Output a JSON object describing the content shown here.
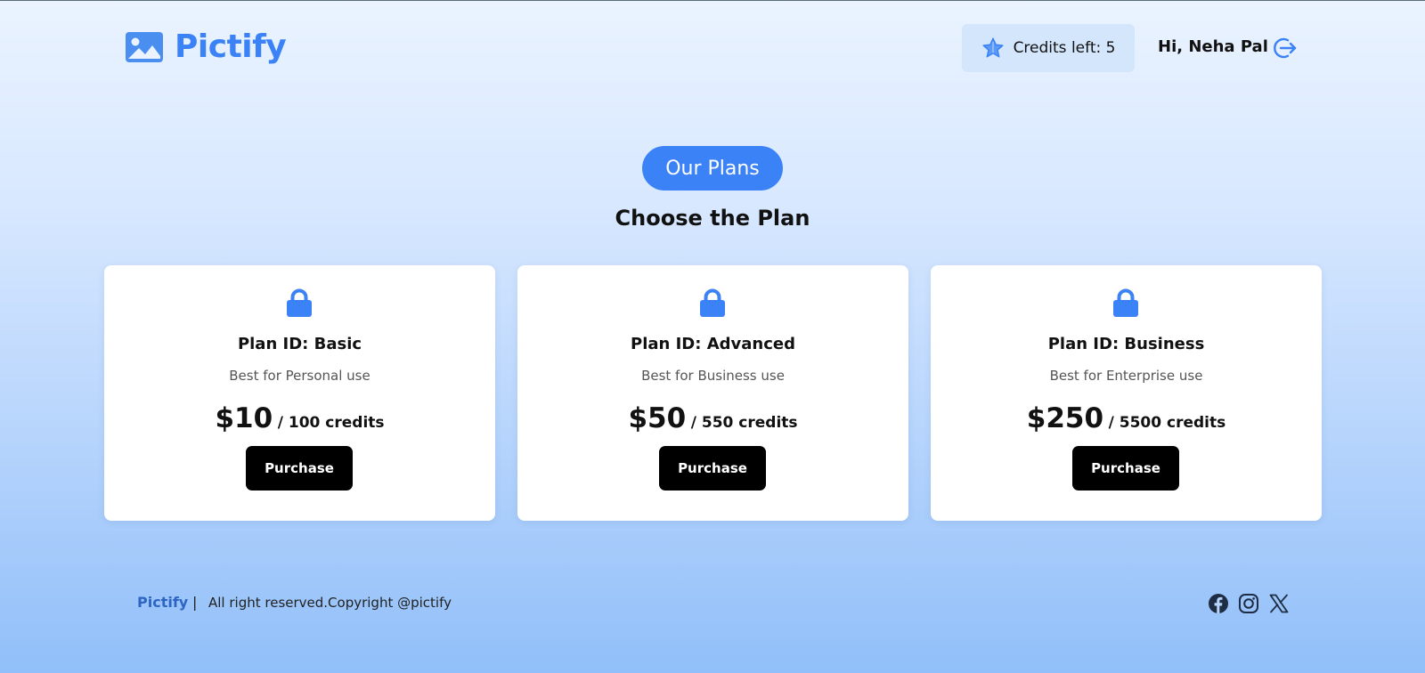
{
  "header": {
    "brand": "Pictify",
    "credits_label": "Credits left: 5",
    "greeting": "Hi, Neha Pal"
  },
  "section": {
    "pill": "Our Plans",
    "title": "Choose the Plan"
  },
  "plans": [
    {
      "id": "Plan ID: Basic",
      "desc": "Best for Personal use",
      "price": "$10",
      "credits": "/ 100 credits",
      "button": "Purchase"
    },
    {
      "id": "Plan ID: Advanced",
      "desc": "Best for Business use",
      "price": "$50",
      "credits": "/ 550 credits",
      "button": "Purchase"
    },
    {
      "id": "Plan ID: Business",
      "desc": "Best for Enterprise use",
      "price": "$250",
      "credits": "/ 5500 credits",
      "button": "Purchase"
    }
  ],
  "footer": {
    "brand": "Pictify",
    "separator": "|",
    "copyright": "All right reserved.Copyright @pictify"
  },
  "icons": {
    "logo": "image-icon",
    "credits": "star-icon",
    "logout": "logout-icon",
    "plan": "lock-icon",
    "social": [
      "facebook-icon",
      "instagram-icon",
      "x-icon"
    ]
  },
  "colors": {
    "accent": "#3b82f6",
    "button": "#000000",
    "credits_bg": "#d3e6fc",
    "footer_brand": "#2e64c4"
  }
}
